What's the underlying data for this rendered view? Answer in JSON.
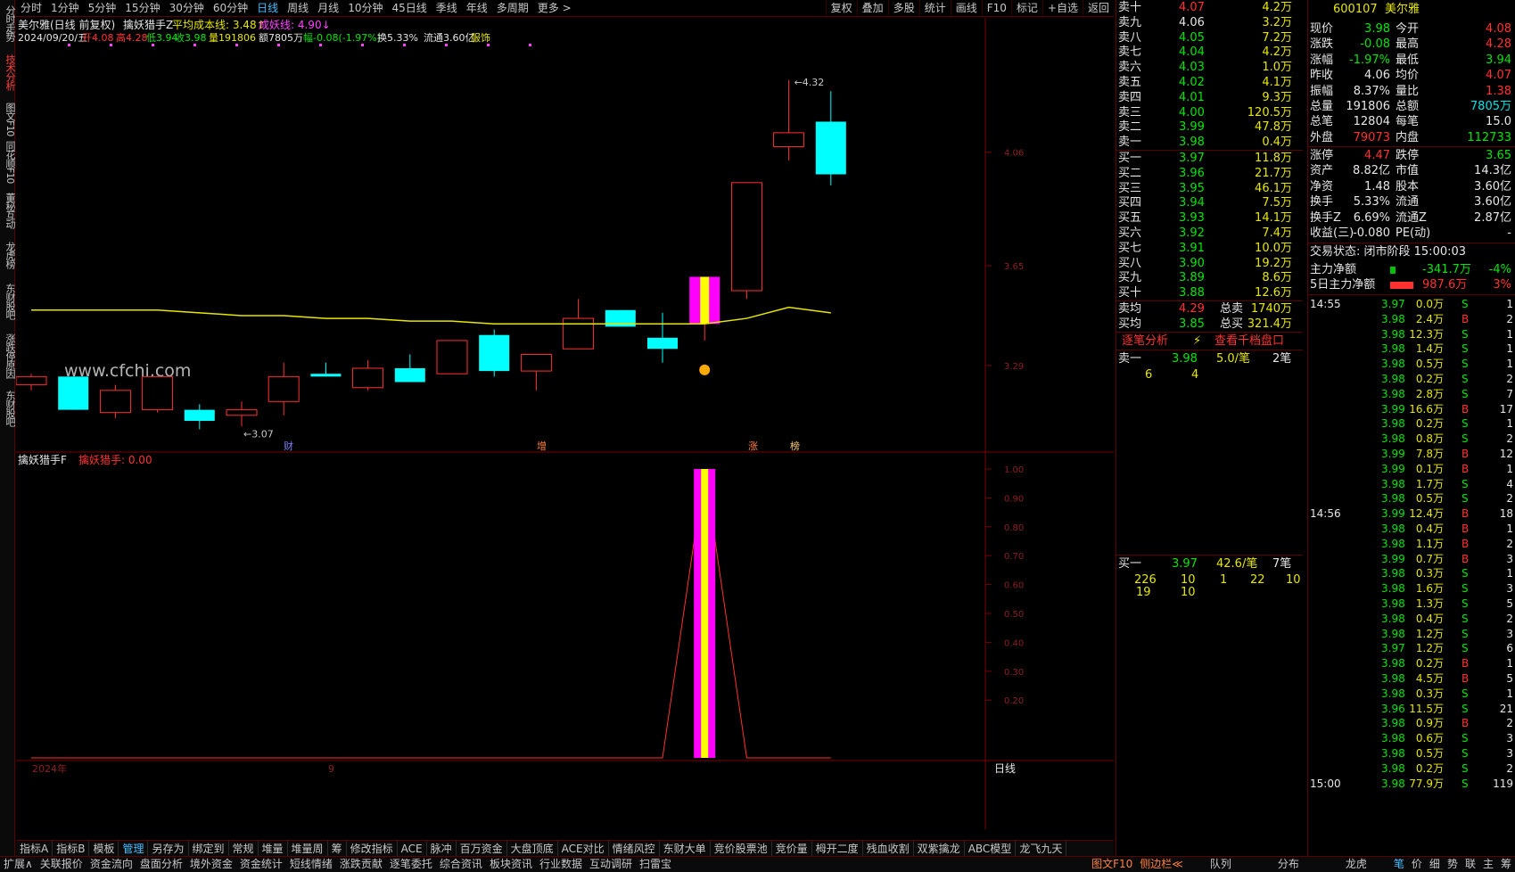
{
  "left_tabs": [
    "分时走势",
    "技术分析",
    "图文F10",
    "同花顺F10",
    "董秘互动",
    "龙虎榜",
    "东财股吧",
    "涨跌停原因",
    "东财股吧"
  ],
  "top_tabs": [
    "分时",
    "1分钟",
    "5分钟",
    "15分钟",
    "30分钟",
    "60分钟",
    "日线",
    "周线",
    "月线",
    "10分钟",
    "45日线",
    "季线",
    "年线",
    "多周期",
    "更多 >"
  ],
  "top_active": "日线",
  "top_right": [
    "复权",
    "叠加",
    "多股",
    "统计",
    "画线",
    "F10",
    "标记",
    "+自选",
    "返回"
  ],
  "chart_title": {
    "name": "美尔雅(日线 前复权)",
    "indicator": "擒妖猎手Z",
    "avg_cost": "平均成本线: 3.48↑",
    "yao_line": "成妖线: 4.90↓"
  },
  "info_line": {
    "date": "2024/09/20/五",
    "open": "开4.08",
    "high": "高4.28",
    "low": "低3.94",
    "close": "收3.98",
    "vol": "量191806",
    "amt": "额7805万",
    "chg": "幅-0.08(-1.97%)",
    "turn": "换5.33%",
    "float": "流通3.60亿",
    "sector": "服饰"
  },
  "chart_labels": {
    "high_mark": "4.32",
    "low_mark": "3.07",
    "watermark": "www.cfchi.com",
    "axis": [
      "4.06",
      "3.65",
      "3.29"
    ],
    "bottom_marks": [
      "财",
      "增",
      "涨",
      "榜"
    ]
  },
  "sub_title": {
    "name": "擒妖猎手F",
    "value": "擒妖猎手: 0.00"
  },
  "sub_axis": [
    "1.00",
    "0.90",
    "0.80",
    "0.70",
    "0.60",
    "0.50",
    "0.40",
    "0.30",
    "0.20"
  ],
  "x_axis": {
    "year": "2024年",
    "month": "9",
    "period": "日线"
  },
  "chart_data": {
    "type": "candlestick",
    "ohlc": [
      [
        3.22,
        3.26,
        3.2,
        3.25
      ],
      [
        3.25,
        3.25,
        3.13,
        3.13
      ],
      [
        3.12,
        3.22,
        3.1,
        3.2
      ],
      [
        3.13,
        3.25,
        3.12,
        3.25
      ],
      [
        3.13,
        3.15,
        3.06,
        3.09
      ],
      [
        3.11,
        3.16,
        3.07,
        3.13
      ],
      [
        3.16,
        3.3,
        3.11,
        3.25
      ],
      [
        3.26,
        3.3,
        3.25,
        3.25
      ],
      [
        3.21,
        3.31,
        3.2,
        3.28
      ],
      [
        3.28,
        3.33,
        3.24,
        3.23
      ],
      [
        3.26,
        3.38,
        3.26,
        3.38
      ],
      [
        3.4,
        3.42,
        3.25,
        3.27
      ],
      [
        3.27,
        3.32,
        3.2,
        3.33
      ],
      [
        3.35,
        3.53,
        3.35,
        3.46
      ],
      [
        3.49,
        3.49,
        3.43,
        3.43
      ],
      [
        3.39,
        3.48,
        3.3,
        3.35
      ],
      [
        3.44,
        3.61,
        3.38,
        3.61
      ],
      [
        3.56,
        3.95,
        3.53,
        3.95
      ],
      [
        4.08,
        4.32,
        4.03,
        4.13
      ],
      [
        4.17,
        4.28,
        3.94,
        3.98
      ]
    ],
    "ma": [
      3.49,
      3.49,
      3.49,
      3.49,
      3.48,
      3.47,
      3.47,
      3.46,
      3.46,
      3.45,
      3.45,
      3.44,
      3.44,
      3.44,
      3.44,
      3.44,
      3.44,
      3.46,
      3.5,
      3.48
    ],
    "signal": [
      0,
      0,
      0,
      0,
      0,
      0,
      0,
      0,
      0,
      0,
      0,
      0,
      0,
      0,
      0,
      0,
      1,
      0,
      0,
      0
    ],
    "ylim": [
      3.0,
      4.4
    ]
  },
  "quote": {
    "sell": [
      [
        "卖十",
        "4.07",
        "4.2万"
      ],
      [
        "卖九",
        "4.06",
        "3.2万"
      ],
      [
        "卖八",
        "4.05",
        "7.2万"
      ],
      [
        "卖七",
        "4.04",
        "4.2万"
      ],
      [
        "卖六",
        "4.03",
        "1.0万"
      ],
      [
        "卖五",
        "4.02",
        "4.1万"
      ],
      [
        "卖四",
        "4.01",
        "9.3万"
      ],
      [
        "卖三",
        "4.00",
        "120.5万"
      ],
      [
        "卖二",
        "3.99",
        "47.8万"
      ],
      [
        "卖一",
        "3.98",
        "0.4万"
      ]
    ],
    "buy": [
      [
        "买一",
        "3.97",
        "11.8万"
      ],
      [
        "买二",
        "3.96",
        "21.7万"
      ],
      [
        "买三",
        "3.95",
        "46.1万"
      ],
      [
        "买四",
        "3.94",
        "7.5万"
      ],
      [
        "买五",
        "3.93",
        "14.1万"
      ],
      [
        "买六",
        "3.92",
        "7.4万"
      ],
      [
        "买七",
        "3.91",
        "10.0万"
      ],
      [
        "买八",
        "3.90",
        "19.2万"
      ],
      [
        "买九",
        "3.89",
        "8.6万"
      ],
      [
        "买十",
        "3.88",
        "12.6万"
      ]
    ],
    "avg": [
      [
        "卖均",
        "4.29",
        "总卖",
        "1740万"
      ],
      [
        "买均",
        "3.85",
        "总买",
        "321.4万"
      ]
    ],
    "tabs": [
      "逐笔分析",
      "查看千档盘口"
    ],
    "sell1": [
      "卖一",
      "3.98",
      "5.0/笔",
      "2笔"
    ],
    "sell1_q": [
      "6",
      "4"
    ],
    "buy1": [
      "买一",
      "3.97",
      "42.6/笔",
      "7笔"
    ],
    "buy1_q": [
      "226",
      "10",
      "1",
      "22",
      "10",
      "19",
      "10"
    ]
  },
  "stock": {
    "code": "600107",
    "name": "美尔雅",
    "stats": [
      [
        "现价",
        "3.98",
        "今开",
        "4.08"
      ],
      [
        "涨跌",
        "-0.08",
        "最高",
        "4.28"
      ],
      [
        "涨幅",
        "-1.97%",
        "最低",
        "3.94"
      ],
      [
        "昨收",
        "4.06",
        "均价",
        "4.07"
      ],
      [
        "振幅",
        "8.37%",
        "量比",
        "1.38"
      ],
      [
        "总量",
        "191806",
        "总额",
        "7805万"
      ],
      [
        "总笔",
        "12804",
        "每笔",
        "15.0"
      ],
      [
        "外盘",
        "79073",
        "内盘",
        "112733"
      ]
    ],
    "stats2": [
      [
        "涨停",
        "4.47",
        "跌停",
        "3.65"
      ],
      [
        "资产",
        "8.82亿",
        "市值",
        "14.3亿"
      ],
      [
        "净资",
        "1.48",
        "股本",
        "3.60亿"
      ],
      [
        "换手",
        "5.33%",
        "流通",
        "3.60亿"
      ],
      [
        "换手Z",
        "6.69%",
        "流通Z",
        "2.87亿"
      ],
      [
        "收益(三)",
        "-0.080",
        "PE(动)",
        "-"
      ]
    ],
    "status": "交易状态: 闭市阶段 15:00:03",
    "flow": [
      [
        "主力净额",
        "-341.7万",
        "-4%"
      ],
      [
        "5日主力净额",
        "987.6万",
        "3%"
      ]
    ]
  },
  "ticks": [
    [
      "14:55",
      "3.97",
      "0.0万",
      "S",
      "1"
    ],
    [
      "",
      "3.98",
      "2.4万",
      "B",
      "2"
    ],
    [
      "",
      "3.98",
      "12.3万",
      "S",
      "1"
    ],
    [
      "",
      "3.98",
      "1.4万",
      "S",
      "1"
    ],
    [
      "",
      "3.98",
      "0.5万",
      "S",
      "1"
    ],
    [
      "",
      "3.98",
      "0.2万",
      "S",
      "2"
    ],
    [
      "",
      "3.98",
      "2.8万",
      "S",
      "7"
    ],
    [
      "",
      "3.99",
      "16.6万",
      "B",
      "17"
    ],
    [
      "",
      "3.98",
      "0.2万",
      "S",
      "1"
    ],
    [
      "",
      "3.98",
      "0.8万",
      "S",
      "2"
    ],
    [
      "",
      "3.99",
      "7.8万",
      "B",
      "12"
    ],
    [
      "",
      "3.99",
      "0.1万",
      "B",
      "1"
    ],
    [
      "",
      "3.98",
      "1.7万",
      "S",
      "4"
    ],
    [
      "",
      "3.98",
      "0.5万",
      "S",
      "2"
    ],
    [
      "14:56",
      "3.99",
      "12.4万",
      "B",
      "18"
    ],
    [
      "",
      "3.98",
      "0.4万",
      "B",
      "1"
    ],
    [
      "",
      "3.98",
      "1.1万",
      "B",
      "2"
    ],
    [
      "",
      "3.99",
      "0.7万",
      "B",
      "3"
    ],
    [
      "",
      "3.98",
      "0.3万",
      "S",
      "1"
    ],
    [
      "",
      "3.98",
      "1.6万",
      "S",
      "3"
    ],
    [
      "",
      "3.98",
      "1.3万",
      "S",
      "5"
    ],
    [
      "",
      "3.98",
      "0.4万",
      "S",
      "2"
    ],
    [
      "",
      "3.98",
      "1.2万",
      "S",
      "3"
    ],
    [
      "",
      "3.97",
      "1.2万",
      "S",
      "6"
    ],
    [
      "",
      "3.98",
      "0.2万",
      "B",
      "1"
    ],
    [
      "",
      "3.98",
      "4.5万",
      "B",
      "5"
    ],
    [
      "",
      "3.98",
      "0.3万",
      "S",
      "1"
    ],
    [
      "",
      "3.96",
      "11.5万",
      "S",
      "21"
    ],
    [
      "",
      "3.98",
      "0.9万",
      "B",
      "2"
    ],
    [
      "",
      "3.98",
      "0.6万",
      "S",
      "3"
    ],
    [
      "",
      "3.98",
      "0.5万",
      "S",
      "3"
    ],
    [
      "",
      "3.98",
      "0.2万",
      "S",
      "2"
    ],
    [
      "15:00",
      "3.98",
      "77.9万",
      "S",
      "119"
    ]
  ],
  "bottom_tabs": [
    "指标A",
    "指标B",
    "模板",
    "管理",
    "另存为",
    "绑定到",
    "常规",
    "堆量",
    "堆量周",
    "筹",
    "修改指标",
    "ACE",
    "脉冲",
    "百万资金",
    "大盘顶底",
    "ACE对比",
    "情绪风控",
    "东财大单",
    "竞价股票池",
    "竞价量",
    "栂开二度",
    "残血收割",
    "双紫擒龙",
    "ABC模型",
    "龙飞九天"
  ],
  "footer": [
    "扩展∧",
    "关联报价",
    "资金流向",
    "盘面分析",
    "境外资金",
    "资金统计",
    "短线情绪",
    "涨跌贡献",
    "逐笔委托",
    "综合资讯",
    "板块资讯",
    "行业数据",
    "互动调研",
    "扫雷宝"
  ],
  "footer_right": [
    "图文F10",
    "侧边栏≪",
    "队列",
    "分布",
    "龙虎",
    "笔",
    "价",
    "细",
    "势",
    "联",
    "主",
    "筹"
  ]
}
